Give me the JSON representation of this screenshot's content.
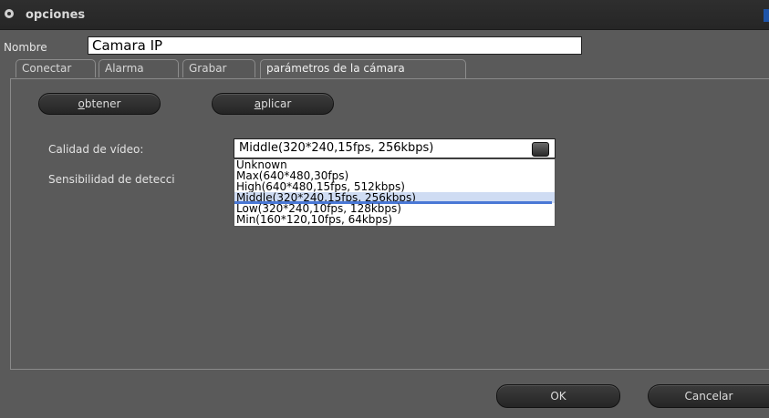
{
  "window": {
    "title": "opciones"
  },
  "name_field": {
    "label": "Nombre",
    "value": "Camara IP"
  },
  "tabs": [
    {
      "label": "Conectar"
    },
    {
      "label": "Alarma"
    },
    {
      "label": "Grabar"
    },
    {
      "label": "parámetros de la cámara",
      "active": true
    }
  ],
  "buttons": {
    "get": {
      "mnemonic": "o",
      "rest": "btener"
    },
    "apply": {
      "mnemonic": "a",
      "rest": "plicar"
    },
    "ok": "OK",
    "cancel": "Cancelar"
  },
  "video_quality": {
    "label": "Calidad de vídeo:",
    "selected": "Middle(320*240,15fps, 256kbps)",
    "options": [
      "Unknown",
      "Max(640*480,30fps)",
      "High(640*480,15fps, 512kbps)",
      "Middle(320*240,15fps, 256kbps)",
      "Low(320*240,10fps, 128kbps)",
      "Min(160*120,10fps, 64kbps)"
    ],
    "selected_index": 3
  },
  "detection": {
    "label": "Sensibilidad de detecci"
  },
  "colors": {
    "background": "#5a5a5a",
    "titlebar": "#2a2a2a",
    "selection": "#4a78d6"
  }
}
